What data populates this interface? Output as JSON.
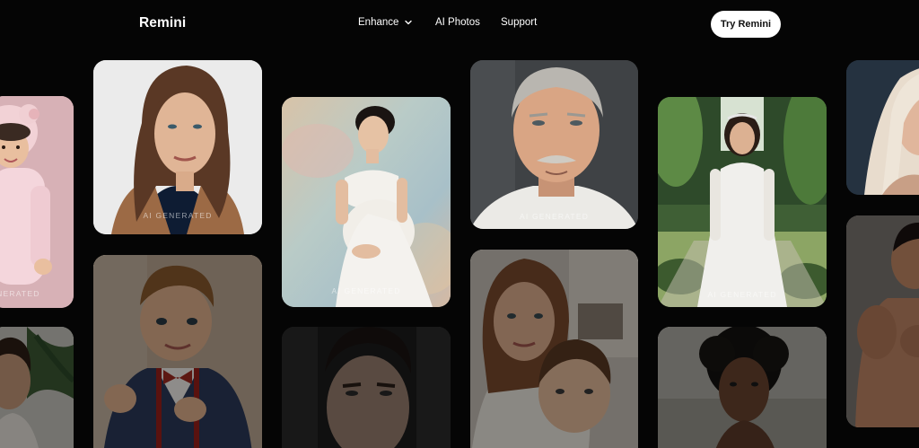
{
  "brand": {
    "name": "Remini"
  },
  "nav": {
    "items": [
      {
        "label": "Enhance",
        "has_dropdown": true
      },
      {
        "label": "AI Photos",
        "has_dropdown": false
      },
      {
        "label": "Support",
        "has_dropdown": false
      }
    ]
  },
  "cta": {
    "label": "Try Remini"
  },
  "gallery": {
    "watermark": "AI GENERATED",
    "tiles": [
      {
        "subject": "child in pink bunny hood",
        "watermark_visible": true,
        "dimmed": false
      },
      {
        "subject": "woman with long brown hair in tan blazer",
        "watermark_visible": true,
        "dimmed": false
      },
      {
        "subject": "pregnant woman in white gown",
        "watermark_visible": true,
        "dimmed": false
      },
      {
        "subject": "older man with grey hair",
        "watermark_visible": true,
        "dimmed": false
      },
      {
        "subject": "bride in lace wedding dress",
        "watermark_visible": true,
        "dimmed": false
      },
      {
        "subject": "woman with blonde hair",
        "watermark_visible": false,
        "dimmed": false
      },
      {
        "subject": "boy with bow tie",
        "watermark_visible": false,
        "dimmed": true
      },
      {
        "subject": "man portrait",
        "watermark_visible": false,
        "dimmed": true
      },
      {
        "subject": "mother with child",
        "watermark_visible": false,
        "dimmed": true
      },
      {
        "subject": "woman with curly hair",
        "watermark_visible": false,
        "dimmed": true
      },
      {
        "subject": "shirtless man",
        "watermark_visible": false,
        "dimmed": true
      },
      {
        "subject": "girl with plant",
        "watermark_visible": false,
        "dimmed": true
      }
    ]
  }
}
